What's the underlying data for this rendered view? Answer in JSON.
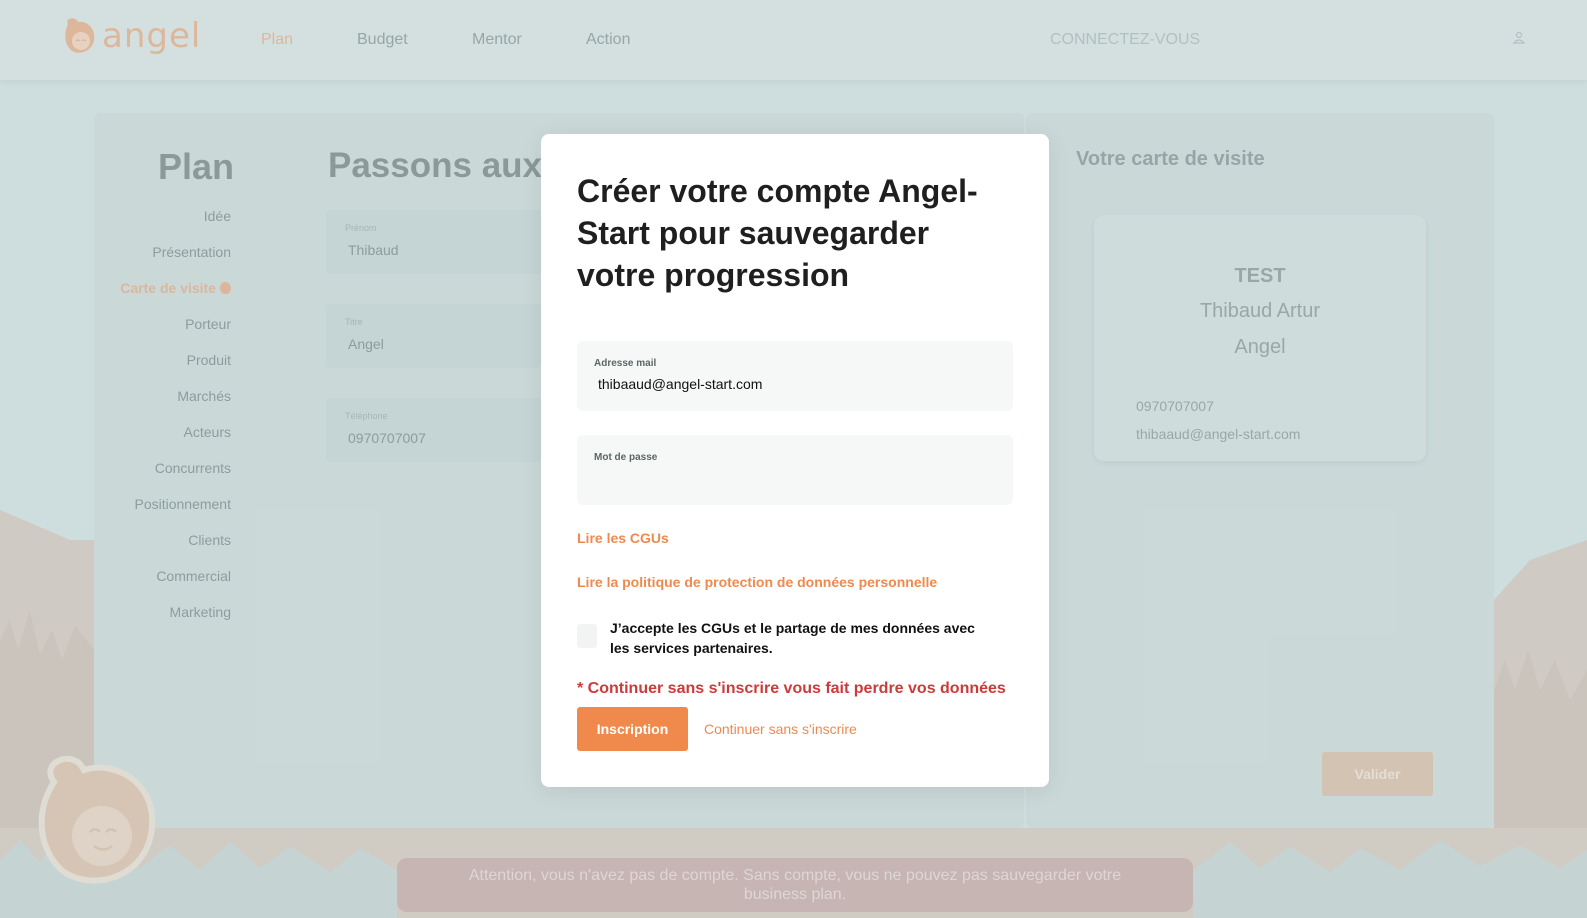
{
  "colors": {
    "accent": "#f08a4c",
    "warning": "#cc3b3b",
    "backdrop": "#d6e4e4"
  },
  "header": {
    "logo_text": "angel",
    "nav": [
      "Plan",
      "Budget",
      "Mentor",
      "Action"
    ],
    "active_nav": "Plan",
    "connect_label": "CONNECTEZ-VOUS",
    "user_icon": "user-icon"
  },
  "sidebar": {
    "title": "Plan",
    "items": [
      "Idée",
      "Présentation",
      "Carte de visite",
      "Porteur",
      "Produit",
      "Marchés",
      "Acteurs",
      "Concurrents",
      "Positionnement",
      "Clients",
      "Commercial",
      "Marketing"
    ],
    "active_item": "Carte de visite"
  },
  "form": {
    "heading": "Passons aux p",
    "fields": [
      {
        "label": "Prénom",
        "value": "Thibaud"
      },
      {
        "label": "Titre",
        "value": "Angel"
      },
      {
        "label": "Téléphone",
        "value": "0970707007"
      }
    ]
  },
  "business_card": {
    "title": "Votre carte de visite",
    "company": "TEST",
    "name": "Thibaud Artur",
    "job": "Angel",
    "phone": "0970707007",
    "email": "thibaaud@angel-start.com",
    "validate_label": "Valider"
  },
  "modal": {
    "title": "Créer votre compte Angel-Start pour sauvegarder votre progression",
    "email_label": "Adresse mail",
    "email_value": "thibaaud@angel-start.com",
    "password_label": "Mot de passe",
    "password_value": "",
    "cgu_link": "Lire les CGUs",
    "privacy_link": "Lire la politique de protection de données personnelle",
    "accept_label": "J’accepte les CGUs et le partage de mes données avec les services partenaires.",
    "accept_checked": false,
    "warning": "* Continuer sans s'inscrire vous fait perdre vos données",
    "signup_label": "Inscription",
    "continue_label": "Continuer sans s'inscrire"
  },
  "footer_warning": "Attention, vous n'avez pas de compte. Sans compte, vous ne pouvez pas sauvegarder votre business plan."
}
